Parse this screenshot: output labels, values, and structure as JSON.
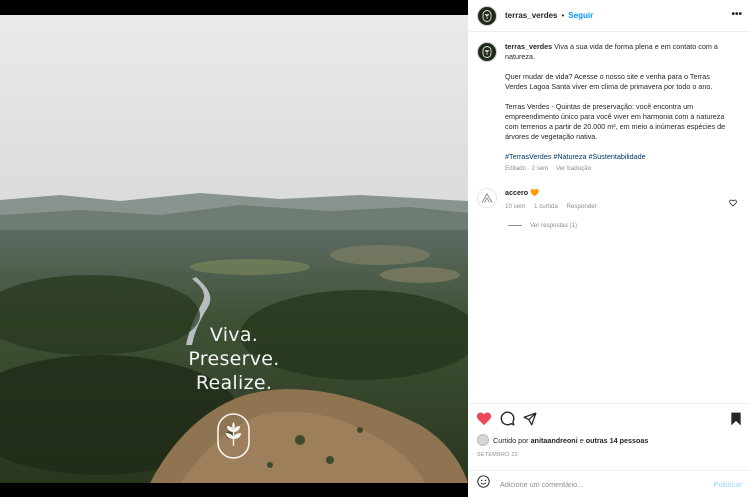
{
  "photo": {
    "overlay_lines": [
      "Viva.",
      "Preserve.",
      "Realize."
    ],
    "emblem_icon": "wheat-leaf-emblem"
  },
  "header": {
    "username": "terras_verdes",
    "separator": "•",
    "follow_label": "Seguir",
    "more_icon": "more-horizontal-icon"
  },
  "caption": {
    "username": "terras_verdes",
    "line1": "Viva a sua vida de forma plena e em contato com a natureza.",
    "paragraph2": "Quer mudar de vida? Acesse o nosso site e venha para o Terras Verdes Lagoa Santa viver em clima de primavera por todo o ano.",
    "paragraph3": "Terras Verdes - Quintas de preservação: você encontra um empreendimento único para você viver em harmonia com a natureza com terrenos a partir de 20.000 m², em meio a inúmeras espécies de árvores de vegetação nativa.",
    "hashtags": "#TerrasVerdes #Natureza #Sustentabilidade",
    "edited": "Editado · 2 sem",
    "see_translation": "Ver tradução"
  },
  "comment": {
    "username": "accero",
    "emoji": "🧡",
    "time": "10 sem",
    "likes": "1 curtida",
    "reply_label": "Responder",
    "view_replies": "Ver respostas (1)"
  },
  "actions": {
    "like_icon": "heart-filled-icon",
    "comment_icon": "comment-icon",
    "share_icon": "share-icon",
    "save_icon": "bookmark-icon"
  },
  "likes_summary": {
    "prefix": "Curtido por",
    "user": "anitaandreoni",
    "middle": "e",
    "others": "outras 14 pessoas"
  },
  "date": "SETEMBRO 22",
  "add_comment": {
    "placeholder": "Adicione um comentário...",
    "publish_label": "Publicar",
    "emoji_icon": "smiley-icon"
  },
  "colors": {
    "follow_blue": "#0095f6",
    "like_red": "#ed4956",
    "hashtag_blue": "#00376b",
    "publish_disabled": "#b2dffc"
  }
}
